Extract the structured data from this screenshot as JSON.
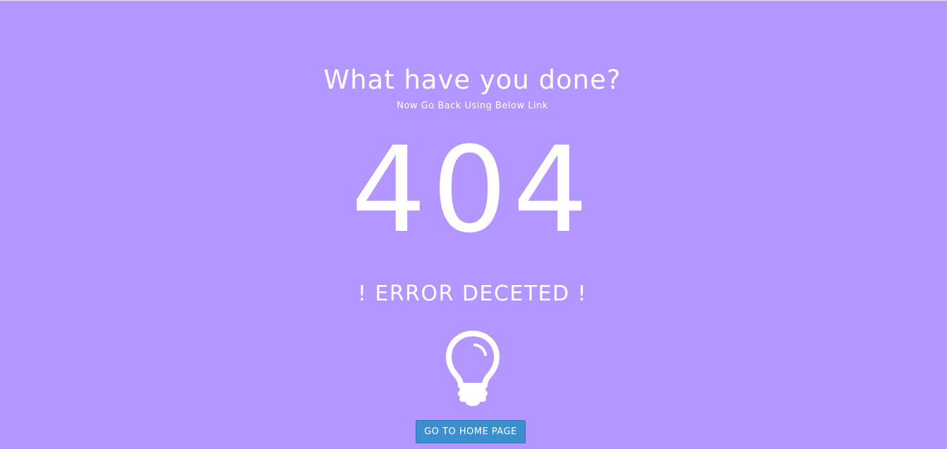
{
  "page": {
    "headline": "What have you done?",
    "subline": "Now Go Back Using Below Link",
    "error_code": "404",
    "error_message": "! ERROR DECETED !",
    "icon": "lightbulb-icon",
    "home_button_label": "GO TO HOME PAGE"
  },
  "colors": {
    "background": "#b396ff",
    "text": "#ffffff",
    "button": "#3c8fcf"
  }
}
